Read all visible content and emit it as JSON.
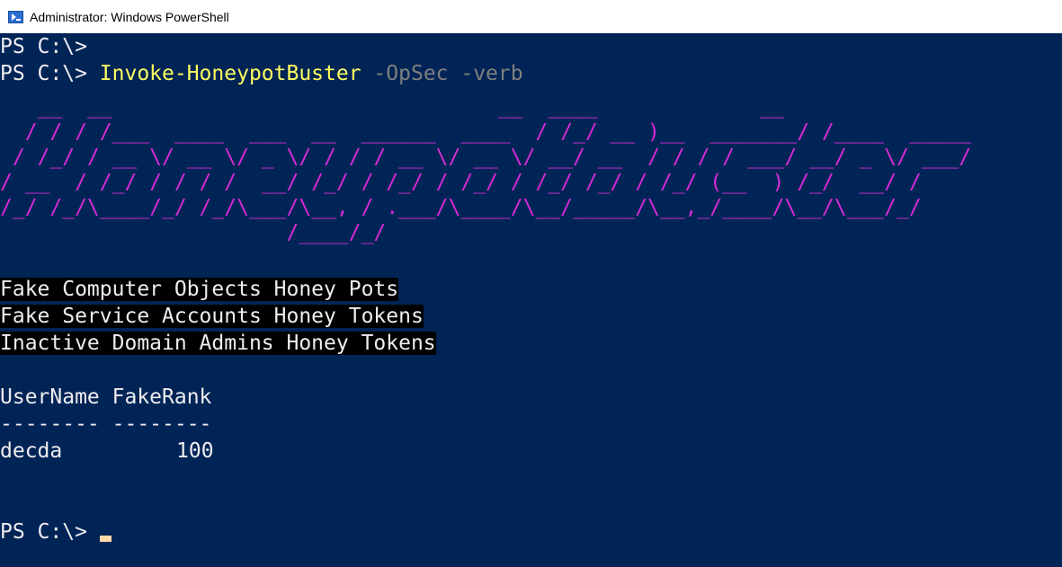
{
  "window": {
    "title": "Administrator: Windows PowerShell"
  },
  "console": {
    "line1_prompt": "PS C:\\> ",
    "line2_prompt": "PS C:\\> ",
    "command_name": "Invoke-HoneypotBuster",
    "command_params": " -OpSec -verb",
    "ascii_banner": "   __  __                               __  ____             __\n  / / / /___  ____  ___  __  ______  ____  / /_/ __ )__  _______/ /____  _____\n / /_/ / __ \\/ __ \\/ _ \\/ / / / __ \\/ __ \\/ __/ __  / / / / ___/ __/ _ \\/ ___/\n/ __  / /_/ / / / /  __/ /_/ / /_/ / /_/ / /_/ /_/ / /_/ (__  ) /_/  __/ /\n/_/ /_/\\____/_/ /_/\\___/\\__, / .___/\\____/\\__/_____/\\__,_/____/\\__/\\___/_/\n                       /____/_/",
    "info_lines": [
      "Fake Computer Objects Honey Pots",
      "Fake Service Accounts Honey Tokens",
      "Inactive Domain Admins Honey Tokens"
    ],
    "table_header": "UserName FakeRank",
    "table_separator": "-------- --------",
    "table_rows": [
      {
        "username": "decda",
        "fakerank": "100"
      }
    ],
    "final_prompt": "PS C:\\> "
  },
  "colors": {
    "background": "#012456",
    "foreground": "#eeedf0",
    "command": "#ffff60",
    "parameter": "#7f7f7f",
    "banner": "#d62bd6",
    "cursor": "#fedba9",
    "highlight_bg": "#000000"
  },
  "icons": {
    "title_icon": "powershell-icon"
  }
}
